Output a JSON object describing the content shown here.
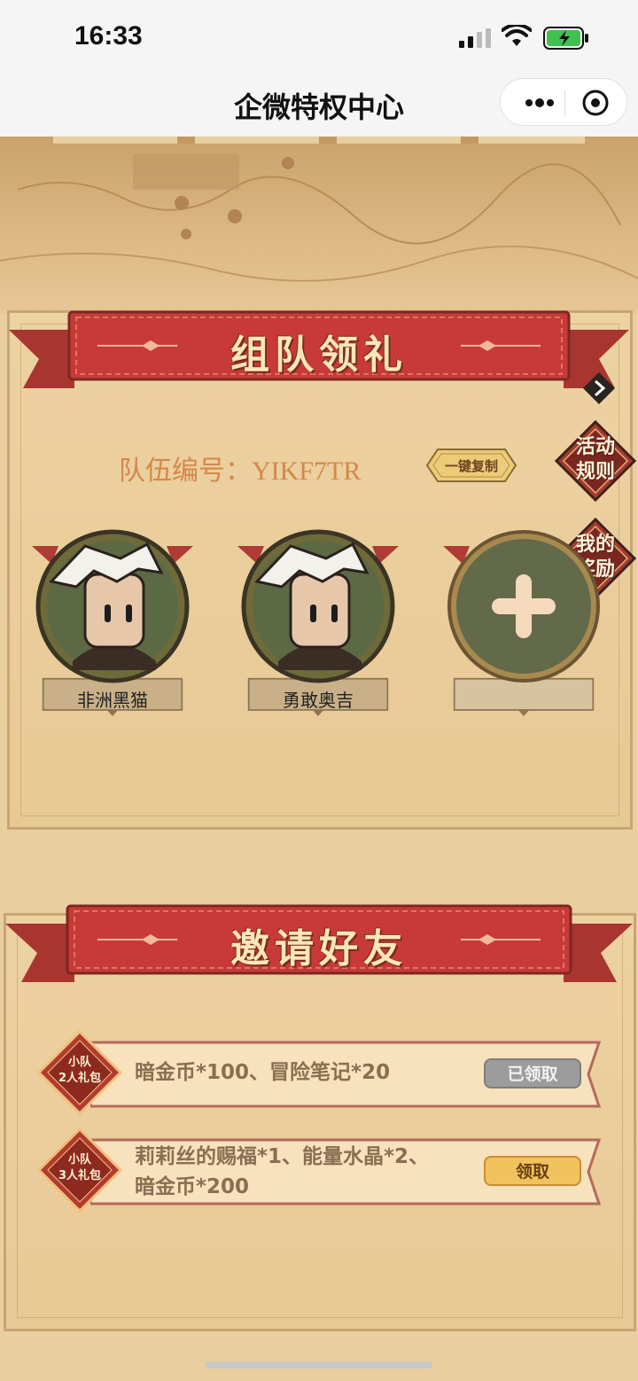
{
  "status": {
    "time": "16:33"
  },
  "nav": {
    "title": "企微特权中心"
  },
  "team": {
    "banner": "组队领礼",
    "label": "队伍编号：YIKF7TR",
    "copy_button": "一键复制",
    "rules_button": [
      "活动",
      "规则"
    ],
    "rewards_button": [
      "我的",
      "奖励"
    ],
    "members": [
      {
        "name": "非洲黑猫"
      },
      {
        "name": "勇敢奥吉"
      }
    ]
  },
  "invite": {
    "banner": "邀请好友",
    "gifts": [
      {
        "badge_top": "小队",
        "badge_bottom": "2人礼包",
        "desc_line1": "暗金币*100、冒险笔记*20",
        "desc_line2": "",
        "button": "已领取",
        "state": "claimed"
      },
      {
        "badge_top": "小队",
        "badge_bottom": "3人礼包",
        "desc_line1": "莉莉丝的赐福*1、能量水晶*2、",
        "desc_line2": "暗金币*200",
        "button": "领取",
        "state": "available"
      }
    ]
  },
  "colors": {
    "banner_red": "#c73a37",
    "accent_gold": "#f1c35e",
    "panel": "#e7c995"
  }
}
